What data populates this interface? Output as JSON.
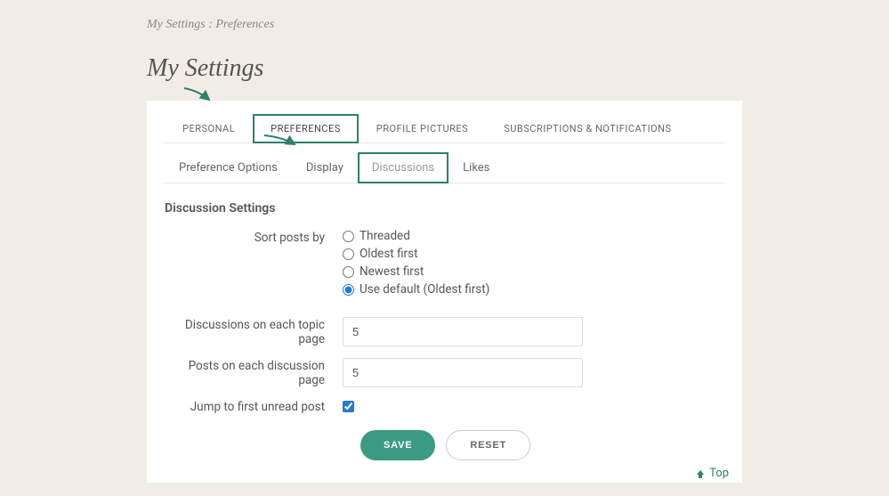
{
  "breadcrumb": "My Settings : Preferences",
  "page_title": "My Settings",
  "primary_tabs": [
    {
      "label": "PERSONAL"
    },
    {
      "label": "PREFERENCES"
    },
    {
      "label": "PROFILE PICTURES"
    },
    {
      "label": "SUBSCRIPTIONS & NOTIFICATIONS"
    }
  ],
  "secondary_tabs": [
    {
      "label": "Preference Options"
    },
    {
      "label": "Display"
    },
    {
      "label": "Discussions"
    },
    {
      "label": "Likes"
    }
  ],
  "section_heading": "Discussion Settings",
  "sort": {
    "label": "Sort posts by",
    "options": [
      {
        "label": "Threaded"
      },
      {
        "label": "Oldest first"
      },
      {
        "label": "Newest first"
      },
      {
        "label": "Use default (Oldest first)"
      }
    ]
  },
  "discussions_per_page": {
    "label": "Discussions on each topic page",
    "value": "5"
  },
  "posts_per_page": {
    "label": "Posts on each discussion page",
    "value": "5"
  },
  "jump_unread": {
    "label": "Jump to first unread post"
  },
  "buttons": {
    "save": "SAVE",
    "reset": "RESET"
  },
  "top_link": "Top"
}
